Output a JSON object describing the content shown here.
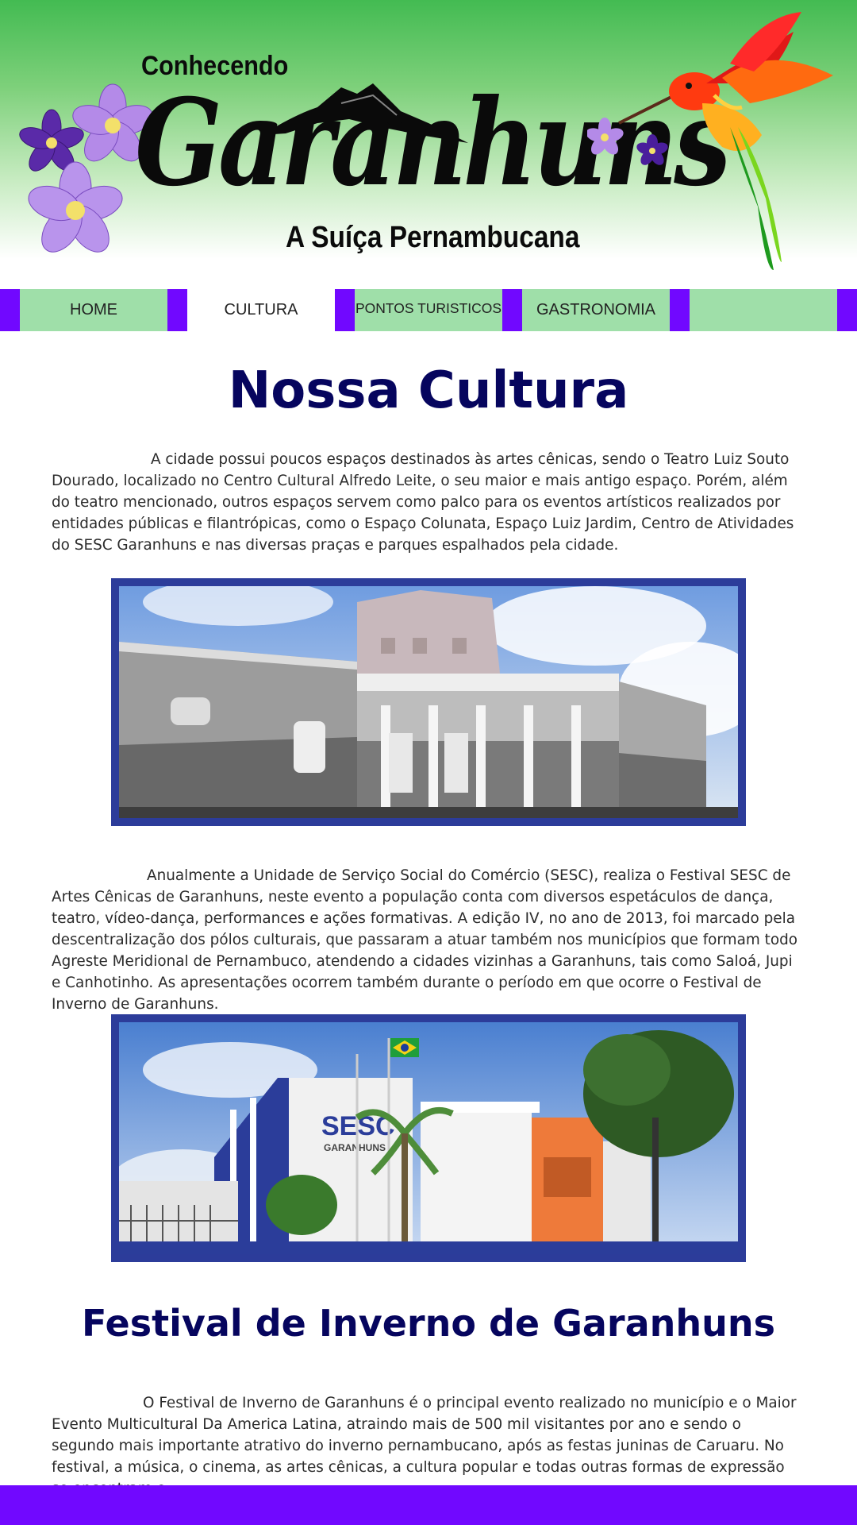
{
  "header": {
    "logo_top": "Conhecendo",
    "logo_main": "Garanhuns",
    "logo_sub": "A Suíça Pernambucana"
  },
  "nav": {
    "items": [
      {
        "label": "HOME"
      },
      {
        "label": "CULTURA"
      },
      {
        "label": "PONTOS TURISTICOS"
      },
      {
        "label": "GASTRONOMIA"
      },
      {
        "label": ""
      }
    ]
  },
  "main": {
    "title": "Nossa Cultura",
    "para1": "A cidade possui poucos espaços destinados às artes cênicas, sendo o Teatro Luiz Souto Dourado, localizado no Centro Cultural Alfredo Leite, o seu maior e mais antigo espaço. Porém, além do teatro mencionado, outros espaços servem como palco para os eventos artísticos realizados por entidades públicas e filantrópicas, como o Espaço Colunata, Espaço Luiz Jardim, Centro de Atividades do SESC Garanhuns e nas diversas praças e parques espalhados pela cidade.",
    "para2": "Anualmente a Unidade de Serviço Social do Comércio (SESC), realiza o Festival SESC de Artes Cênicas de Garanhuns, neste evento a população conta com diversos espetáculos de dança, teatro, vídeo-dança, performances e ações formativas. A edição IV, no ano de 2013, foi marcado pela descentralização dos pólos culturais, que passaram a atuar também nos municípios que formam todo Agreste Meridional de Pernambuco, atendendo a cidades vizinhas a Garanhuns, tais como Saloá, Jupi e Canhotinho. As apresentações ocorrem também durante o período em que ocorre o Festival de Inverno de Garanhuns.",
    "photo2_sign": "SESC",
    "photo2_sign_sub": "GARANHUNS",
    "subtitle": "Festival de Inverno de Garanhuns",
    "para3": "O Festival de Inverno de Garanhuns é o principal evento realizado no município e o Maior Evento Multicultural Da America Latina, atraindo mais de 500 mil visitantes por ano e sendo o segundo mais importante atrativo do inverno pernambucano, após as festas juninas de Caruaru. No festival, a música, o cinema, as artes cênicas, a cultura popular e todas outras formas de expressão se encontram e"
  },
  "colors": {
    "nav_bar": "#7108ff",
    "nav_green": "#9fdfa9",
    "heading": "#06055e",
    "photo_frame": "#2c3c9a"
  }
}
